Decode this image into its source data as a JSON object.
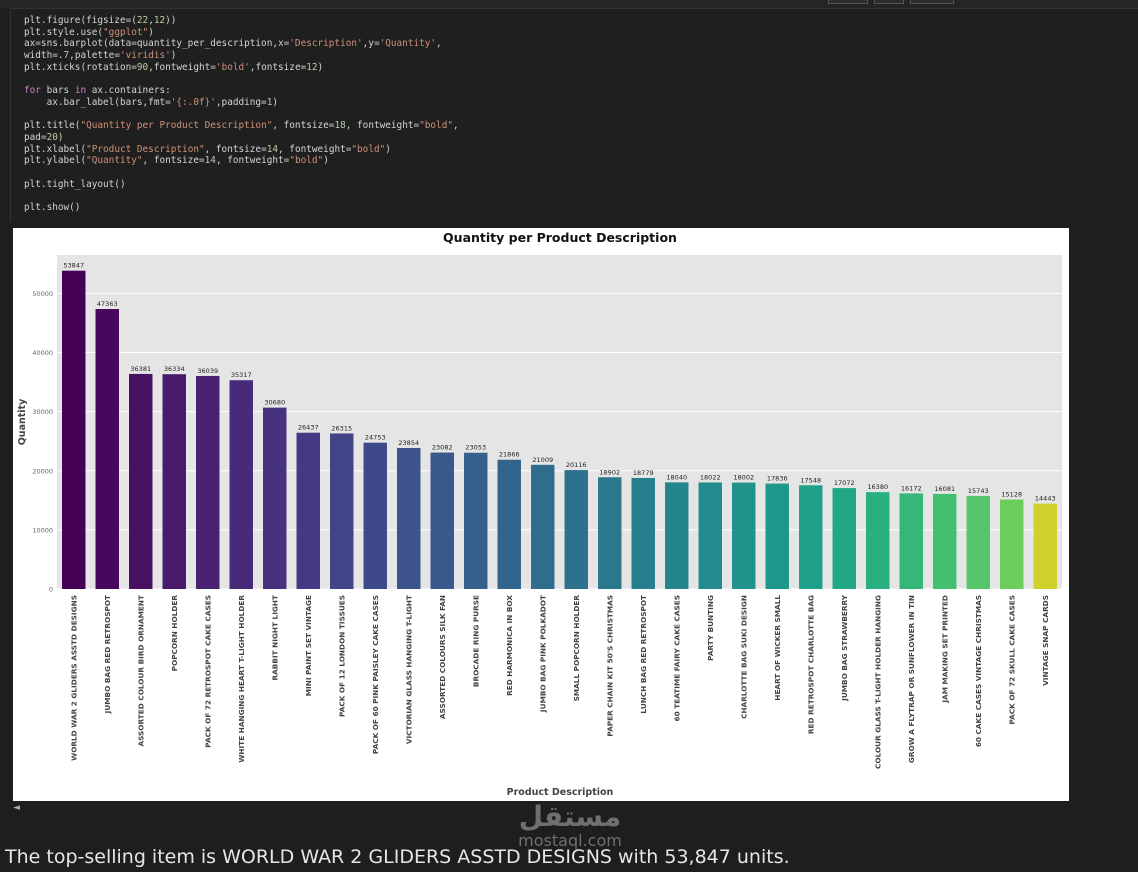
{
  "code": {
    "lines": [
      "plt.figure(figsize=(22,12))",
      "plt.style.use(\"ggplot\")",
      "ax=sns.barplot(data=quantity_per_description,x='Description',y='Quantity',",
      "width=.7,palette='viridis')",
      "plt.xticks(rotation=90,fontweight='bold',fontsize=12)",
      "",
      "for bars in ax.containers:",
      "    ax.bar_label(bars,fmt='{:.0f}',padding=1)",
      "",
      "plt.title(\"Quantity per Product Description\", fontsize=18, fontweight=\"bold\",",
      "pad=20)",
      "plt.xlabel(\"Product Description\", fontsize=14, fontweight=\"bold\")",
      "plt.ylabel(\"Quantity\", fontsize=14, fontweight=\"bold\")",
      "",
      "plt.tight_layout()",
      "",
      "plt.show()"
    ]
  },
  "chart_data": {
    "type": "bar",
    "title": "Quantity per Product Description",
    "xlabel": "Product Description",
    "ylabel": "Quantity",
    "ylim": [
      0,
      56500
    ],
    "yticks": [
      0,
      10000,
      20000,
      30000,
      40000,
      50000
    ],
    "grid": true,
    "categories": [
      "WORLD WAR 2 GLIDERS ASSTD DESIGNS",
      "JUMBO BAG RED RETROSPOT",
      "ASSORTED COLOUR BIRD ORNAMENT",
      "POPCORN HOLDER",
      "PACK OF 72 RETROSPOT CAKE CASES",
      "WHITE HANGING HEART T-LIGHT HOLDER",
      "RABBIT NIGHT LIGHT",
      "MINI PAINT SET VINTAGE",
      "PACK OF 12 LONDON TISSUES",
      "PACK OF 60 PINK PAISLEY CAKE CASES",
      "VICTORIAN GLASS HANGING T-LIGHT",
      "ASSORTED COLOURS SILK FAN",
      "BROCADE RING PURSE",
      "RED  HARMONICA IN BOX",
      "JUMBO BAG PINK POLKADOT",
      "SMALL POPCORN HOLDER",
      "PAPER CHAIN KIT 50'S CHRISTMAS",
      "LUNCH BAG RED RETROSPOT",
      "60 TEATIME FAIRY CAKE CASES",
      "PARTY BUNTING",
      "CHARLOTTE BAG SUKI DESIGN",
      "HEART OF WICKER SMALL",
      "RED RETROSPOT CHARLOTTE BAG",
      "JUMBO BAG STRAWBERRY",
      "COLOUR GLASS T-LIGHT HOLDER HANGING",
      "GROW A FLYTRAP OR SUNFLOWER IN TIN",
      "JAM MAKING SET PRINTED",
      "60 CAKE CASES VINTAGE CHRISTMAS",
      "PACK OF 72 SKULL CAKE CASES",
      "VINTAGE SNAP CARDS"
    ],
    "values": [
      53847,
      47363,
      36381,
      36334,
      36039,
      35317,
      30680,
      26437,
      26315,
      24753,
      23854,
      23082,
      23053,
      21866,
      21009,
      20116,
      18902,
      18779,
      18040,
      18022,
      18002,
      17836,
      17548,
      17072,
      16380,
      16172,
      16081,
      15743,
      15128,
      14443
    ],
    "value_labels": [
      "53847",
      "47363",
      "36381",
      "36334",
      "36039",
      "35317",
      "30680",
      "26437",
      "26315",
      "24753",
      "23854",
      "23082",
      "23053",
      "21866",
      "21009",
      "20116",
      "18902",
      "18779",
      "18040",
      "18022",
      "18002",
      "17836",
      "17548",
      "17072",
      "16380",
      "16172",
      "16081",
      "15743",
      "15128",
      "14443"
    ],
    "colors": [
      "#440154",
      "#46085c",
      "#471063",
      "#481a6c",
      "#482173",
      "#472a7a",
      "#46327e",
      "#443983",
      "#414487",
      "#3e4989",
      "#3b528b",
      "#38598c",
      "#355f8d",
      "#32658e",
      "#2f6c8e",
      "#2c728e",
      "#2a788e",
      "#277f8e",
      "#25858e",
      "#228b8d",
      "#20928c",
      "#1f988b",
      "#1fa088",
      "#22a785",
      "#2ab07f",
      "#35b779",
      "#43bf71",
      "#54c568",
      "#6ccd5a",
      "#d0d12b"
    ]
  },
  "output": {
    "watermark_ar": "مستقل",
    "watermark_en": "mostaql.com",
    "summary": "The top-selling item is WORLD WAR 2 GLIDERS ASSTD DESIGNS with 53,847 units.",
    "caret": "◄"
  }
}
